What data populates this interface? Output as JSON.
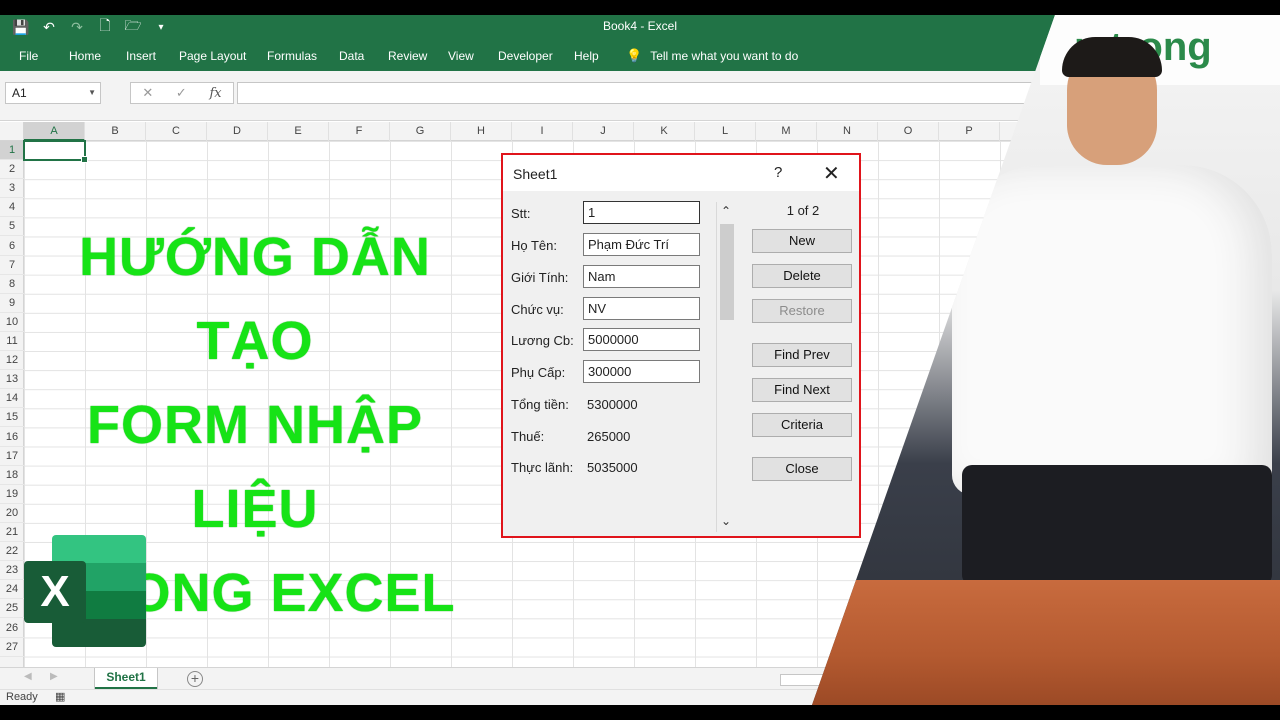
{
  "window": {
    "title": "Book4  -  Excel"
  },
  "ribbon": {
    "tabs": [
      "File",
      "Home",
      "Insert",
      "Page Layout",
      "Formulas",
      "Data",
      "Review",
      "View",
      "Developer",
      "Help"
    ],
    "tell_me": "Tell me what you want to do"
  },
  "formula_bar": {
    "name_box": "A1",
    "fx_label": "fx",
    "cancel": "✕",
    "enter": "✓"
  },
  "grid": {
    "columns": [
      "A",
      "B",
      "C",
      "D",
      "E",
      "F",
      "G",
      "H",
      "I",
      "J",
      "K",
      "L",
      "M",
      "N",
      "O",
      "P"
    ],
    "rows": [
      "1",
      "2",
      "3",
      "4",
      "5",
      "6",
      "7",
      "8",
      "9",
      "10",
      "11",
      "12",
      "13",
      "14",
      "15",
      "16",
      "17",
      "18",
      "19",
      "20",
      "21",
      "22",
      "23",
      "24",
      "25",
      "26",
      "27"
    ]
  },
  "headline": {
    "line1": "HƯỚNG DẪN TẠO",
    "line2": "FORM NHẬP LIỆU",
    "line3": "TRONG EXCEL"
  },
  "logo": {
    "letter": "X",
    "colors": [
      "#33c481",
      "#21a366",
      "#107c41",
      "#185c37"
    ]
  },
  "dialog": {
    "title": "Sheet1",
    "help": "?",
    "close": "✕",
    "fields": [
      {
        "label": "Stt:",
        "value": "1"
      },
      {
        "label": "Họ Tên:",
        "value": "Phạm Đức Trí"
      },
      {
        "label": "Giới Tính:",
        "value": "Nam"
      },
      {
        "label": "Chức vụ:",
        "value": "NV"
      },
      {
        "label": "Lương Cb:",
        "value": "5000000"
      },
      {
        "label": "Phụ Cấp:",
        "value": "300000"
      }
    ],
    "computed": [
      {
        "label": "Tổng tiền:",
        "value": "5300000"
      },
      {
        "label": "Thuế:",
        "value": "265000"
      },
      {
        "label": "Thực lãnh:",
        "value": "5035000"
      }
    ],
    "record": "1 of 2",
    "buttons": {
      "new": "New",
      "delete": "Delete",
      "restore": "Restore",
      "find_prev": "Find Prev",
      "find_next": "Find Next",
      "criteria": "Criteria",
      "close": "Close"
    }
  },
  "sheet_tabs": {
    "active": "Sheet1",
    "add": "+"
  },
  "status": {
    "ready": "Ready"
  },
  "photo": {
    "banner": "n trong"
  },
  "colors": {
    "excel_green": "#217346",
    "headline": "#16e316",
    "dialog_border": "#e0141b"
  }
}
